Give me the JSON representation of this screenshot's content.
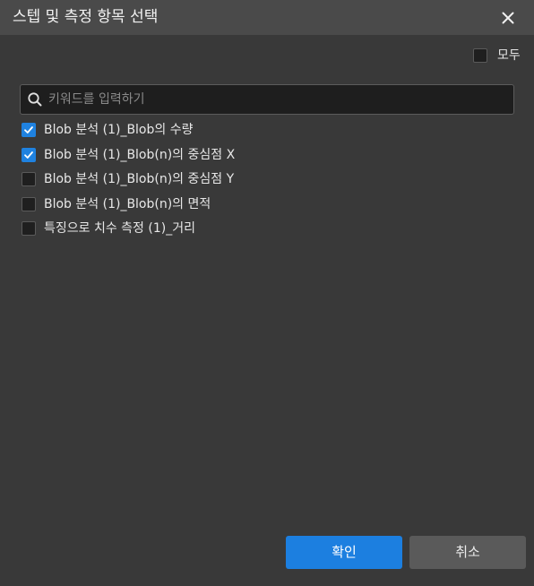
{
  "dialog": {
    "title": "스텝 및 측정 항목 선택",
    "select_all_label": "모두",
    "select_all_checked": false
  },
  "search": {
    "placeholder": "키워드를 입력하기",
    "value": ""
  },
  "items": [
    {
      "label": "Blob 분석 (1)_Blob의 수량",
      "checked": true
    },
    {
      "label": "Blob 분석 (1)_Blob(n)의 중심점 X",
      "checked": true
    },
    {
      "label": "Blob 분석 (1)_Blob(n)의 중심점 Y",
      "checked": false
    },
    {
      "label": "Blob 분석 (1)_Blob(n)의 면적",
      "checked": false
    },
    {
      "label": "특징으로 치수 측정 (1)_거리",
      "checked": false
    }
  ],
  "buttons": {
    "ok_label": "확인",
    "cancel_label": "취소"
  },
  "colors": {
    "accent": "#1f82e0",
    "background": "#393939",
    "titlebar": "#4a4a4a"
  },
  "icons": {
    "close": "close-icon",
    "search": "search-icon",
    "check": "check-icon"
  }
}
